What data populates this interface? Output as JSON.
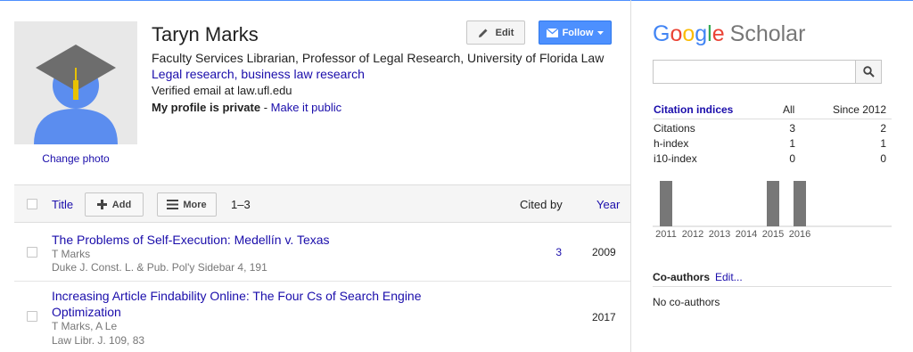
{
  "profile": {
    "name": "Taryn Marks",
    "affiliation": "Faculty Services Librarian, Professor of Legal Research, University of Florida Law",
    "interests": [
      "Legal research",
      "business law research"
    ],
    "verified_email": "Verified email at law.ufl.edu",
    "private_label": "My profile is private",
    "private_sep": " - ",
    "make_public_link": "Make it public",
    "change_photo": "Change photo"
  },
  "buttons": {
    "edit": "Edit",
    "follow": "Follow",
    "add": "Add",
    "more": "More"
  },
  "table": {
    "title_header": "Title",
    "range": "1–3",
    "cited_by_header": "Cited by",
    "year_header": "Year",
    "rows": [
      {
        "title": "The Problems of Self-Execution: Medellín v. Texas",
        "authors": "T Marks",
        "venue": "Duke J. Const. L. & Pub. Pol'y Sidebar 4, 191",
        "cited_by": "3",
        "year": "2009"
      },
      {
        "title": "Increasing Article Findability Online: The Four Cs of Search Engine Optimization",
        "authors": "T Marks, A Le",
        "venue": "Law Libr. J. 109, 83",
        "cited_by": "",
        "year": "2017"
      }
    ]
  },
  "sidebar": {
    "logo_letters": [
      "G",
      "o",
      "o",
      "g",
      "l",
      "e"
    ],
    "logo_suffix": "Scholar",
    "citation_indices_label": "Citation indices",
    "col_all": "All",
    "col_since": "Since 2012",
    "indices": [
      {
        "label": "Citations",
        "all": "3",
        "since": "2"
      },
      {
        "label": "h-index",
        "all": "1",
        "since": "1"
      },
      {
        "label": "i10-index",
        "all": "0",
        "since": "0"
      }
    ],
    "coauthors_label": "Co-authors",
    "coauthors_edit": "Edit...",
    "no_coauthors": "No co-authors"
  },
  "chart_data": {
    "type": "bar",
    "categories": [
      "2011",
      "2012",
      "2013",
      "2014",
      "2015",
      "2016"
    ],
    "values": [
      1,
      0,
      0,
      0,
      1,
      1
    ],
    "ylim": [
      0,
      1
    ],
    "grid": false,
    "bar_color": "#777777"
  }
}
